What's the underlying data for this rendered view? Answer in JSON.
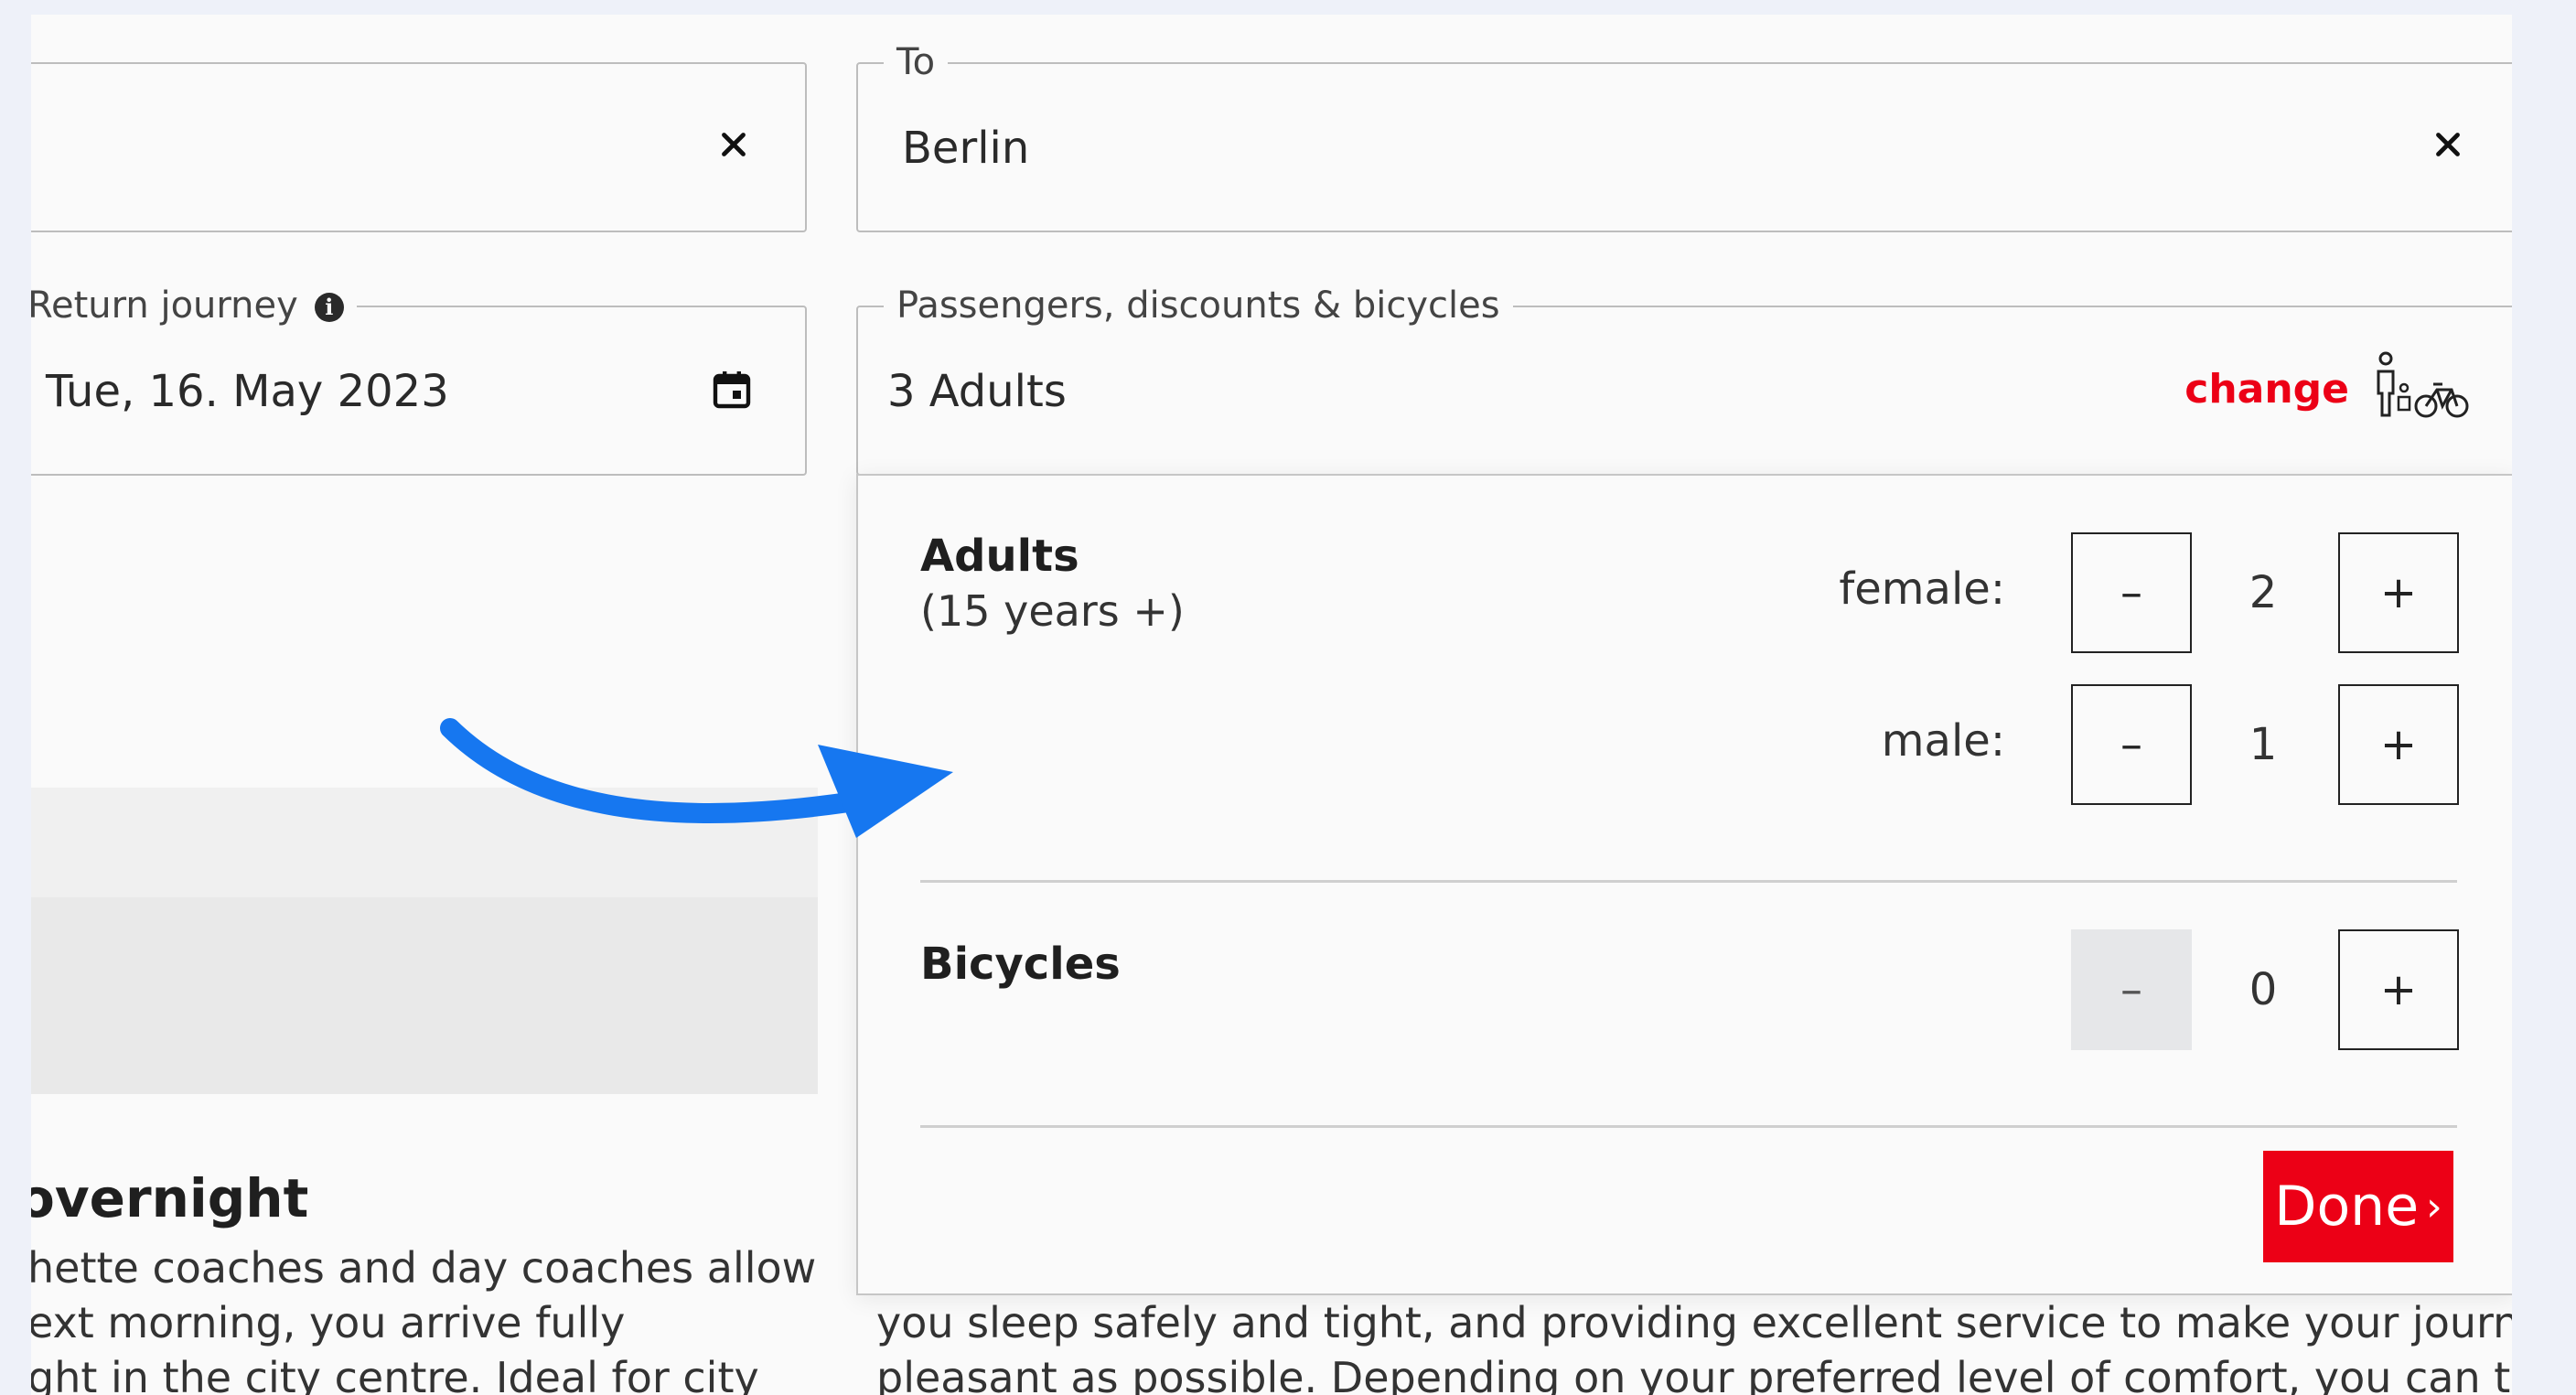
{
  "from_field": {
    "clear_icon": "close-icon"
  },
  "to_field": {
    "legend": "To",
    "value": "Berlin",
    "clear_icon": "close-icon"
  },
  "return_field": {
    "legend": "Return journey",
    "info_icon": "info-icon",
    "value": "Tue, 16. May 2023",
    "calendar_icon": "calendar-icon"
  },
  "passengers_field": {
    "legend": "Passengers, discounts & bicycles",
    "value": "3 Adults",
    "change_label": "change",
    "icon": "passengers-bicycle-icon"
  },
  "popup": {
    "adults": {
      "title": "Adults",
      "subtitle": "(15 years +)",
      "rows": [
        {
          "label": "female:",
          "count": "2"
        },
        {
          "label": "male:",
          "count": "1"
        }
      ]
    },
    "bicycles": {
      "title": "Bicycles",
      "count": "0"
    },
    "minus_label": "–",
    "plus_label": "+",
    "done_label": "Done",
    "done_chevron": "›"
  },
  "background_text": {
    "left_title": "overnight",
    "left_lines": [
      "hette coaches and day coaches allow",
      "ext morning, you arrive fully",
      "ght in the city centre. Ideal for city"
    ],
    "right_lines": [
      "you sleep safely and tight, and providing excellent service to make your journey as",
      "pleasant as possible. Depending on your preferred level of comfort, you can travel"
    ]
  },
  "colors": {
    "accent_red": "#ec0016",
    "arrow_blue": "#1677f0"
  }
}
